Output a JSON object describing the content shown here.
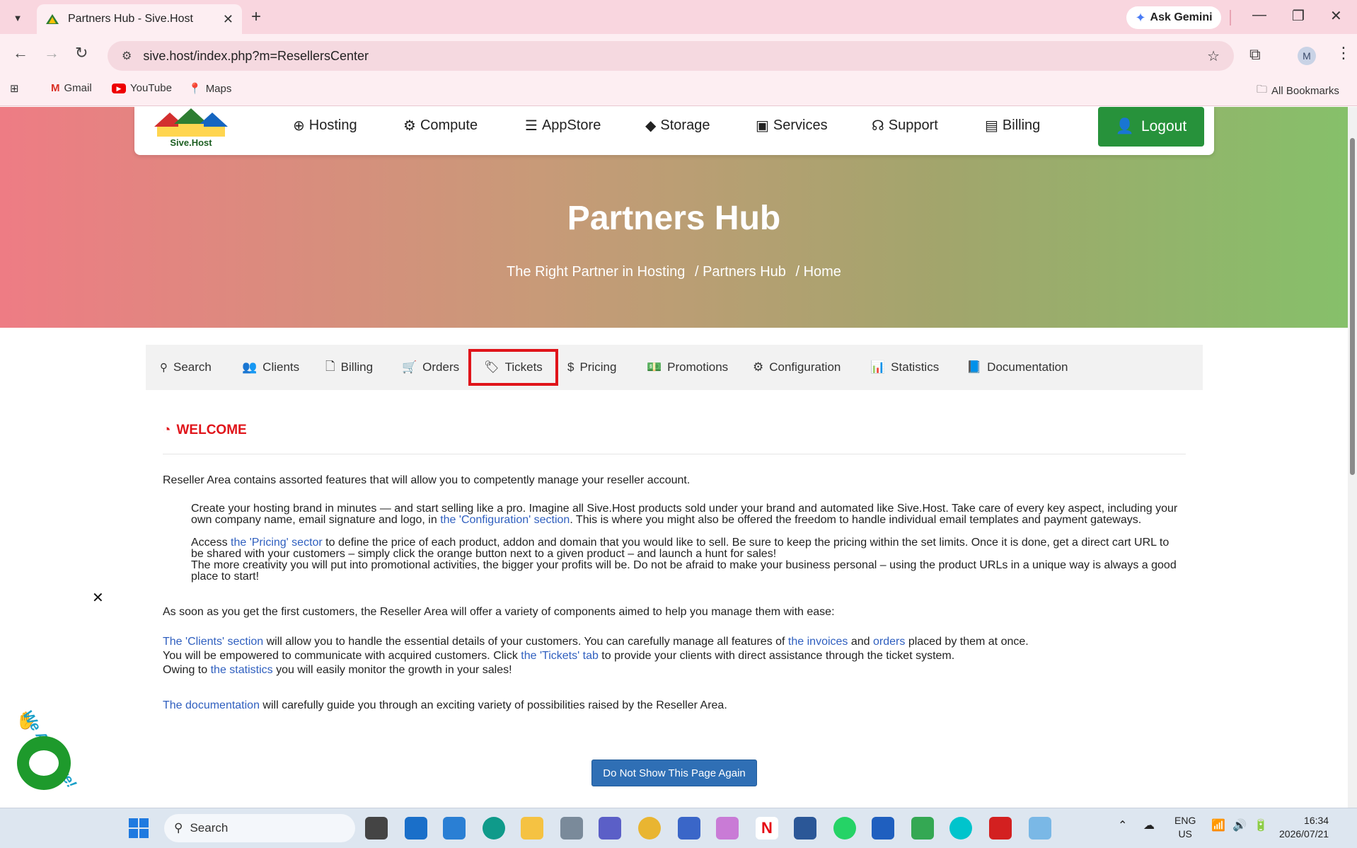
{
  "browser": {
    "tab_title": "Partners Hub - Sive.Host",
    "tab_close": "✕",
    "new_tab": "+",
    "ask_gemini": "Ask Gemini",
    "url": "sive.host/index.php?m=ResellersCenter",
    "profile_initial": "M",
    "bookmarks": [
      {
        "label": "Gmail",
        "icon": "gmail-icon"
      },
      {
        "label": "YouTube",
        "icon": "youtube-icon"
      },
      {
        "label": "Maps",
        "icon": "maps-icon"
      }
    ],
    "all_bookmarks": "All Bookmarks"
  },
  "site_nav": {
    "logo_text": "Sive.Host",
    "items": [
      {
        "label": "Hosting",
        "icon": "globe-icon",
        "glyph": "⊕"
      },
      {
        "label": "Compute",
        "icon": "gear-icon",
        "glyph": "⚙"
      },
      {
        "label": "AppStore",
        "icon": "database-icon",
        "glyph": "☰"
      },
      {
        "label": "Storage",
        "icon": "box-icon",
        "glyph": "◆"
      },
      {
        "label": "Services",
        "icon": "gift-icon",
        "glyph": "▣"
      },
      {
        "label": "Support",
        "icon": "headset-icon",
        "glyph": "☊"
      },
      {
        "label": "Billing",
        "icon": "document-icon",
        "glyph": "▤"
      }
    ],
    "logout": "Logout"
  },
  "hero": {
    "title": "Partners Hub",
    "breadcrumb": [
      "The Right Partner in Hosting",
      "/ Partners Hub",
      "/ Home"
    ]
  },
  "tabs": [
    {
      "label": "Search",
      "icon": "search-icon",
      "glyph": "🔍"
    },
    {
      "label": "Clients",
      "icon": "users-icon",
      "glyph": "👥"
    },
    {
      "label": "Billing",
      "icon": "file-icon",
      "glyph": "🗋"
    },
    {
      "label": "Orders",
      "icon": "cart-icon",
      "glyph": "🛒"
    },
    {
      "label": "Tickets",
      "icon": "ticket-icon",
      "glyph": "🏷"
    },
    {
      "label": "Pricing",
      "icon": "dollar-icon",
      "glyph": "$"
    },
    {
      "label": "Promotions",
      "icon": "money-icon",
      "glyph": "💵"
    },
    {
      "label": "Configuration",
      "icon": "cogs-icon",
      "glyph": "⚙"
    },
    {
      "label": "Statistics",
      "icon": "bar-chart-icon",
      "glyph": "📊"
    },
    {
      "label": "Documentation",
      "icon": "book-icon",
      "glyph": "📘"
    }
  ],
  "welcome": {
    "heading": "WELCOME",
    "intro": "Reseller Area contains assorted features that will allow you to competently manage your reseller account.",
    "p1_a": "Create your hosting brand in minutes — and start selling like a pro. Imagine all Sive.Host products sold under your brand and automated like Sive.Host. Take care of every key aspect, including your own company name, email signature and logo, in ",
    "p1_link": "the 'Configuration' section",
    "p1_b": ". This is where you might also be offered the freedom to handle individual email templates and payment gateways.",
    "p2_a": "Access ",
    "p2_link": "the 'Pricing' sector",
    "p2_b": " to define the price of each product, addon and domain that you would like to sell. Be sure to keep the pricing within the set limits. Once it is done, get a direct cart URL to be shared with your customers – simply click the orange button next to a given product – and launch a hunt for sales!",
    "p3": "The more creativity you will put into promotional activities, the bigger your profits will be. Do not be afraid to make your business personal – using the product URLs in a unique way is always a good place to start!",
    "first_customers": "As soon as you get the first customers, the Reseller Area will offer a variety of components aimed to help you manage them with ease:",
    "c1_link": "The 'Clients' section",
    "c1_a": " will allow you to handle the essential details of your customers. You can carefully manage all features of ",
    "c1_link2": "the invoices",
    "c1_b": " and ",
    "c1_link3": "orders",
    "c1_c": " placed by them at once.",
    "c2_a": "You will be empowered to communicate with acquired customers. Click ",
    "c2_link": "the 'Tickets' tab",
    "c2_b": " to provide your clients with direct assistance through the ticket system.",
    "c3_a": "Owing to ",
    "c3_link": "the statistics",
    "c3_b": " you will easily monitor the growth in your sales!",
    "doc_link": "The documentation",
    "doc_b": " will carefully guide you through an exciting variety of possibilities raised by the Reseller Area.",
    "button": "Do Not Show This Page Again"
  },
  "chat": {
    "close": "✕",
    "label": "We Are Here!"
  },
  "taskbar": {
    "search": "Search",
    "lang_top": "ENG",
    "lang_bottom": "US",
    "time": "16:34",
    "date": "2026/07/21"
  }
}
